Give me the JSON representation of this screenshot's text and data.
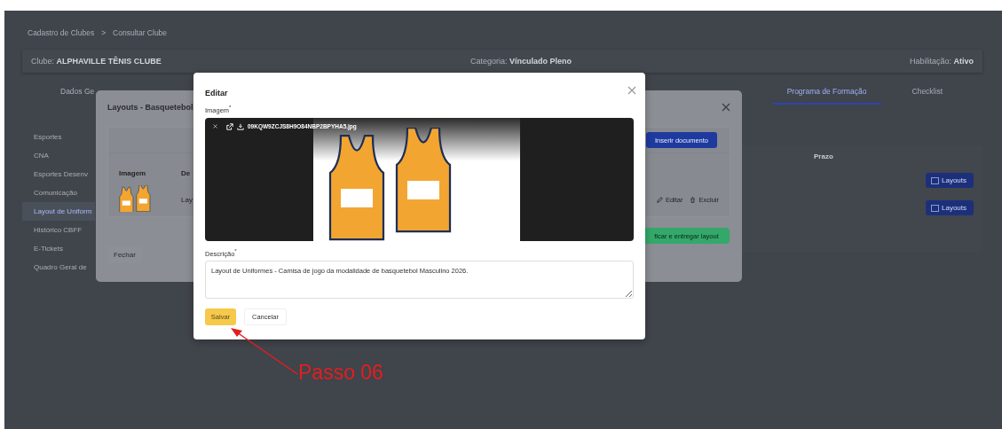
{
  "breadcrumb": [
    "Cadastro de Clubes",
    ">",
    "Consultar Clube"
  ],
  "club_bar": {
    "club_label": "Clube:",
    "club": "ALPHAVILLE TÊNIS CLUBE",
    "category_label": "Categoria:",
    "category": "Vínculado Pleno",
    "status_label": "Habilitação:",
    "status": "Ativo"
  },
  "tabs": [
    {
      "label": "Dados Ge",
      "selected": false
    },
    {
      "label": "Programa de Formação",
      "selected": true
    },
    {
      "label": "Checklist",
      "selected": false
    }
  ],
  "sidebar": {
    "items": [
      {
        "label": "Esportes",
        "selected": false
      },
      {
        "label": "CNA",
        "selected": false
      },
      {
        "label": "Esportes Desenv",
        "selected": false
      },
      {
        "label": "Comunicação",
        "selected": false
      },
      {
        "label": "Layout de Uniform",
        "selected": true
      },
      {
        "label": "Histórico CBFF",
        "selected": false
      },
      {
        "label": "E-Tickets",
        "selected": false
      },
      {
        "label": "Quadro Geral de",
        "selected": false
      }
    ]
  },
  "content": {
    "column_header": "Prazo",
    "buttons": [
      "Layouts",
      "Layouts"
    ]
  },
  "layouts_modal": {
    "title": "Layouts - Basquetebol",
    "insert_button": "Inserir documento",
    "columns": [
      "Imagem",
      "De"
    ],
    "rows": [
      {
        "description": "Lay",
        "actions": [
          "Editar",
          "Excluir"
        ]
      }
    ],
    "submit_button": "ficar e entregar layout",
    "close_button": "Fechar"
  },
  "edit_modal": {
    "title": "Editar",
    "image_label": "Imagem$^{*}$",
    "file_name": "09KQW9ZCJS8H9O84NBP2BPYHA5.jpg",
    "description_label": "Descrição$^{*}$",
    "description": "Layout de Uniformes - Camisa de jogo da modalidade de basquetebol Masculino 2026.",
    "buttons": [
      {
        "label": "Salvar",
        "kind": "primary"
      },
      {
        "label": "Cancelar",
        "kind": "secondary"
      }
    ]
  },
  "annotation": {
    "text": "Passo 06"
  }
}
